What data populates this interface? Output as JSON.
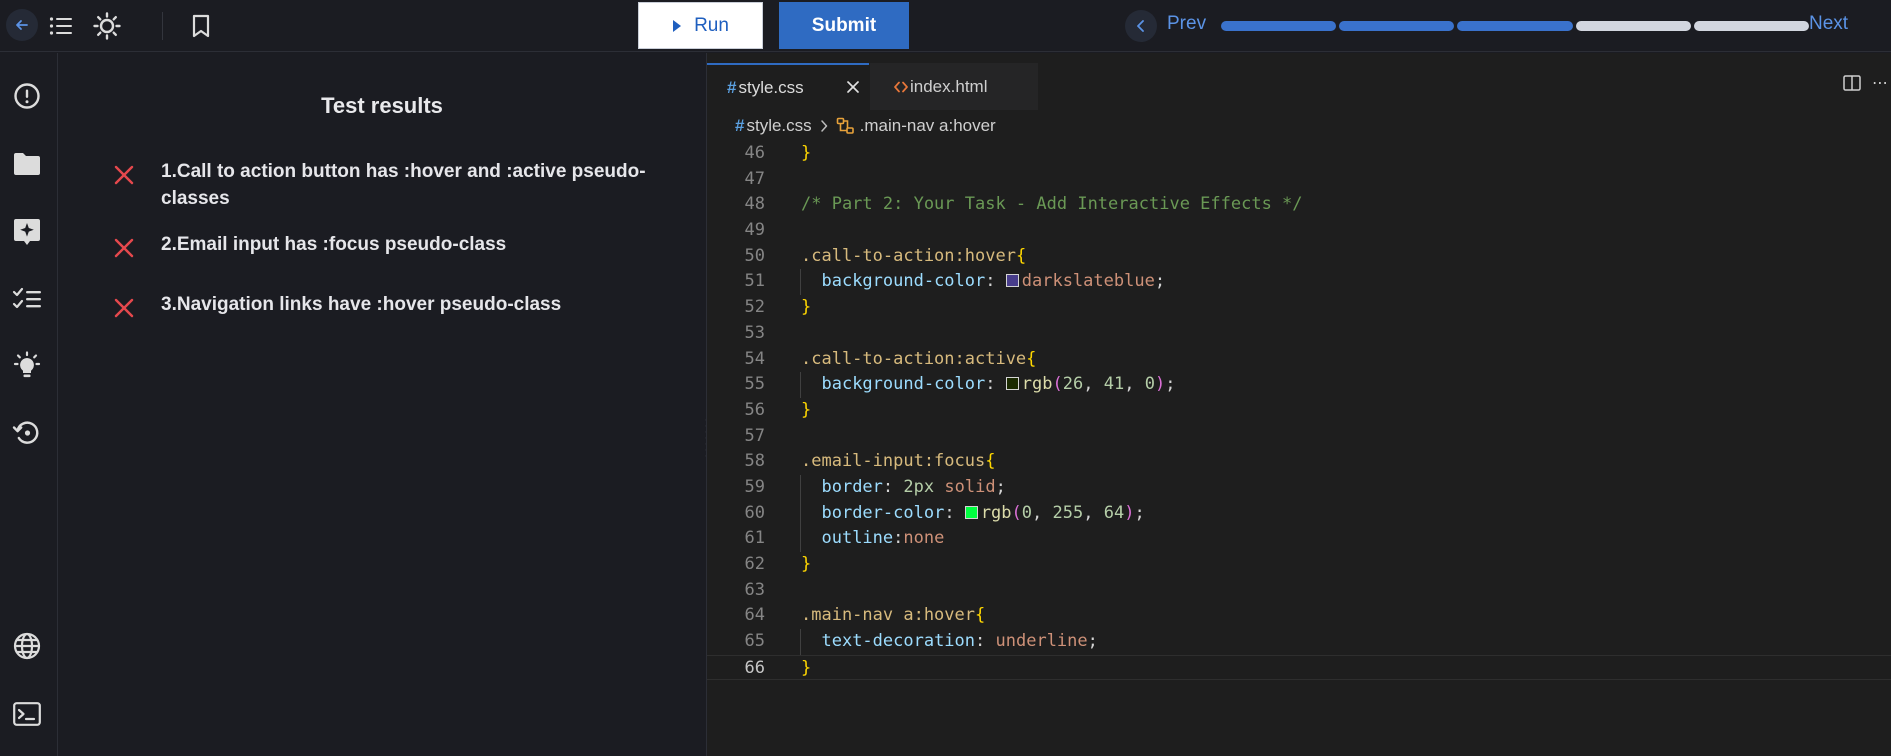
{
  "toolbar": {
    "run_label": "Run",
    "submit_label": "Submit",
    "prev_label": "Prev",
    "next_label": "Next",
    "progress": {
      "total_steps": 5,
      "completed_steps": 3
    },
    "icons": [
      "arrow-left-icon",
      "list-icon",
      "sun-icon",
      "bookmark-icon"
    ]
  },
  "sidebar": {
    "icons": [
      "info-icon",
      "folder-icon",
      "ai-sparkle-icon",
      "checklist-icon",
      "lightbulb-icon",
      "history-icon",
      "globe-icon",
      "terminal-icon"
    ]
  },
  "test_results": {
    "title": "Test results",
    "items": [
      {
        "text": "1.Call to action button has :hover and :active pseudo-classes",
        "status": "failed"
      },
      {
        "text": "2.Email input has :focus pseudo-class",
        "status": "failed"
      },
      {
        "text": "3.Navigation links have :hover pseudo-class",
        "status": "failed"
      }
    ]
  },
  "editor": {
    "tabs": [
      {
        "label": "style.css",
        "active": true
      },
      {
        "label": "index.html",
        "active": false
      }
    ],
    "breadcrumb": {
      "file": "style.css",
      "symbol": ".main-nav a:hover"
    },
    "current_line": 66,
    "lines": [
      {
        "num": "46",
        "text": "}"
      },
      {
        "num": "47",
        "text": ""
      },
      {
        "num": "48",
        "text": "/* Part 2: Your Task - Add Interactive Effects */"
      },
      {
        "num": "49",
        "text": ""
      },
      {
        "num": "50",
        "text": ".call-to-action:hover{"
      },
      {
        "num": "51",
        "text": "  background-color: darkslateblue;"
      },
      {
        "num": "52",
        "text": "}"
      },
      {
        "num": "53",
        "text": ""
      },
      {
        "num": "54",
        "text": ".call-to-action:active{"
      },
      {
        "num": "55",
        "text": "  background-color: rgb(26, 41, 0);"
      },
      {
        "num": "56",
        "text": "}"
      },
      {
        "num": "57",
        "text": ""
      },
      {
        "num": "58",
        "text": ".email-input:focus{"
      },
      {
        "num": "59",
        "text": "  border: 2px solid;"
      },
      {
        "num": "60",
        "text": "  border-color: rgb(0, 255, 64);"
      },
      {
        "num": "61",
        "text": "  outline:none"
      },
      {
        "num": "62",
        "text": "}"
      },
      {
        "num": "63",
        "text": ""
      },
      {
        "num": "64",
        "text": ".main-nav a:hover{"
      },
      {
        "num": "65",
        "text": "  text-decoration: underline;"
      },
      {
        "num": "66",
        "text": "}"
      }
    ],
    "swatches": {
      "51": "#483d8b",
      "55": "#1a2900",
      "60": "#00ff40"
    }
  },
  "colors": {
    "accent": "#2f6bc2",
    "fail": "#e5484d",
    "background": "#1b1c22",
    "editor_background": "#1e1e1e"
  }
}
